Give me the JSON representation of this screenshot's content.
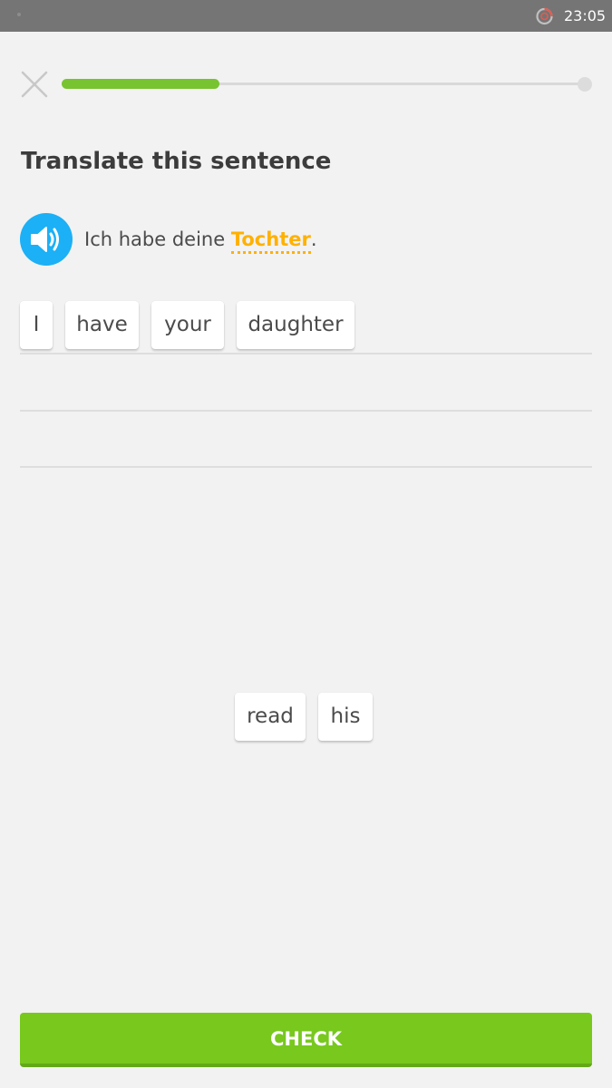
{
  "status_bar": {
    "time": "23:05",
    "icons": [
      "notification-dot-icon",
      "alarm-icon"
    ]
  },
  "lesson": {
    "progress": 0.3,
    "close_icon": "close-icon"
  },
  "prompt": {
    "title": "Translate this sentence",
    "audio_icon": "speaker-icon",
    "sentence_before": "Ich habe deine ",
    "hint_word": "Tochter",
    "sentence_after": "."
  },
  "answer": {
    "selected_tiles": [
      "I",
      "have",
      "your",
      "daughter"
    ]
  },
  "word_bank": {
    "tiles": [
      "read",
      "his"
    ]
  },
  "footer": {
    "check_label": "CHECK"
  },
  "colors": {
    "accent_green": "#78c81e",
    "progress_green": "#78c430",
    "speaker_blue": "#1cb0f6",
    "hint_gold": "#ffb100"
  }
}
